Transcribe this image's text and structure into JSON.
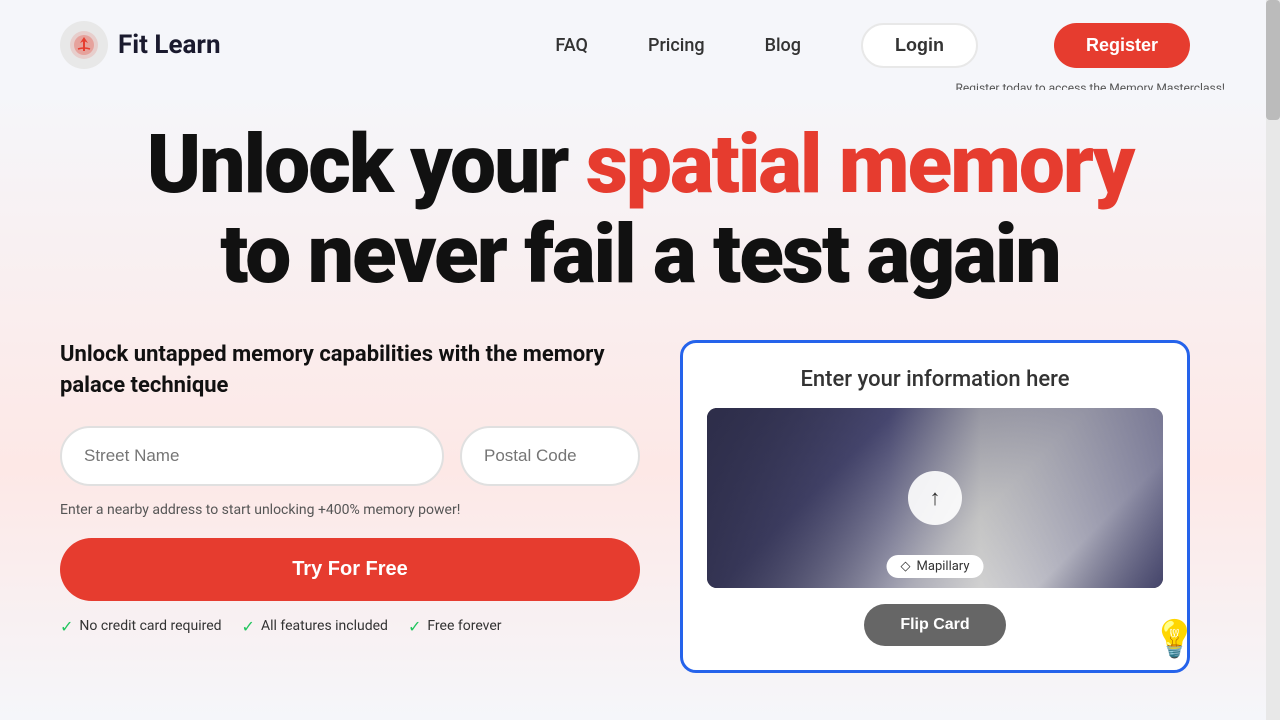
{
  "navbar": {
    "logo_text": "Fit Learn",
    "links": [
      {
        "label": "FAQ",
        "id": "faq"
      },
      {
        "label": "Pricing",
        "id": "pricing"
      },
      {
        "label": "Blog",
        "id": "blog"
      }
    ],
    "login_label": "Login",
    "register_label": "Register",
    "register_tooltip": "Register today to access the Memory Masterclass!"
  },
  "hero": {
    "heading_line1_normal": "Unlock your ",
    "heading_line1_highlight": "spatial memory",
    "heading_line2": "to never fail a test again"
  },
  "left_panel": {
    "subtitle": "Unlock untapped memory capabilities with the memory palace technique",
    "street_placeholder": "Street Name",
    "postal_placeholder": "Postal Code",
    "helper_text": "Enter a nearby address to start unlocking +400% memory power!",
    "cta_label": "Try For Free",
    "features": [
      "No credit card required",
      "All features included",
      "Free forever"
    ]
  },
  "right_panel": {
    "title": "Enter your information here",
    "mapillary_label": "Mapillary",
    "flip_card_label": "Flip Card",
    "upload_icon": "↑"
  }
}
